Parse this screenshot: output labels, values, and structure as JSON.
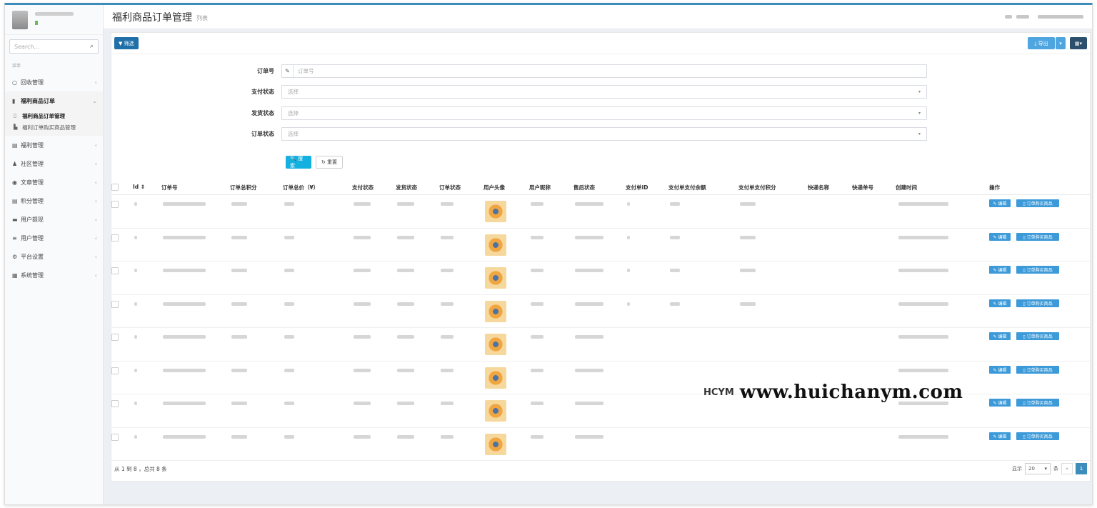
{
  "sidebar": {
    "search_placeholder": "Search...",
    "menu_header": "菜单",
    "items": [
      {
        "label": "回收管理",
        "icon": "circle-icon"
      },
      {
        "label": "福利商品订单",
        "icon": "document-icon",
        "open": true,
        "children": [
          {
            "label": "福利商品订单管理",
            "active": true,
            "icon": "file-icon"
          },
          {
            "label": "福利订单购买商品管理",
            "active": false,
            "icon": "building-icon"
          }
        ]
      },
      {
        "label": "福利管理",
        "icon": "database-icon"
      },
      {
        "label": "社区管理",
        "icon": "users-icon"
      },
      {
        "label": "文章管理",
        "icon": "compass-icon"
      },
      {
        "label": "积分管理",
        "icon": "database-icon"
      },
      {
        "label": "用户提现",
        "icon": "card-icon"
      },
      {
        "label": "用户管理",
        "icon": "list-icon"
      },
      {
        "label": "平台设置",
        "icon": "gears-icon"
      },
      {
        "label": "系统管理",
        "icon": "table-icon"
      }
    ]
  },
  "header": {
    "title": "福利商品订单管理",
    "subtitle": "列表"
  },
  "toolbar": {
    "filter_label": "▼ 筛选",
    "export_label": "⤓ 导出"
  },
  "filters": [
    {
      "label": "订单号",
      "placeholder": "订单号",
      "type": "text"
    },
    {
      "label": "支付状态",
      "placeholder": "选择",
      "type": "select"
    },
    {
      "label": "发货状态",
      "placeholder": "选择",
      "type": "select"
    },
    {
      "label": "订单状态",
      "placeholder": "选择",
      "type": "select"
    }
  ],
  "buttons": {
    "search": "🔍 搜索",
    "reset": "↻ 重置"
  },
  "table": {
    "columns": [
      "Id ⇕",
      "订单号",
      "订单总积分",
      "订单总价（¥）",
      "支付状态",
      "发货状态",
      "订单状态",
      "用户头像",
      "用户昵称",
      "售后状态",
      "支付单ID",
      "支付单支付余额",
      "支付单支付积分",
      "快递名称",
      "快递单号",
      "创建时间",
      "操作"
    ],
    "action_edit": "编辑",
    "action_goods": "订单购买商品",
    "row_count": 8
  },
  "footer": {
    "summary": "从 1 到 8 ，总共 8 条",
    "show_label": "显示",
    "page_size": "20",
    "per_label": "条",
    "current_page": "1",
    "prev": "«"
  },
  "watermark": {
    "logo": "HCYM",
    "site": "www.huichanym.com"
  }
}
